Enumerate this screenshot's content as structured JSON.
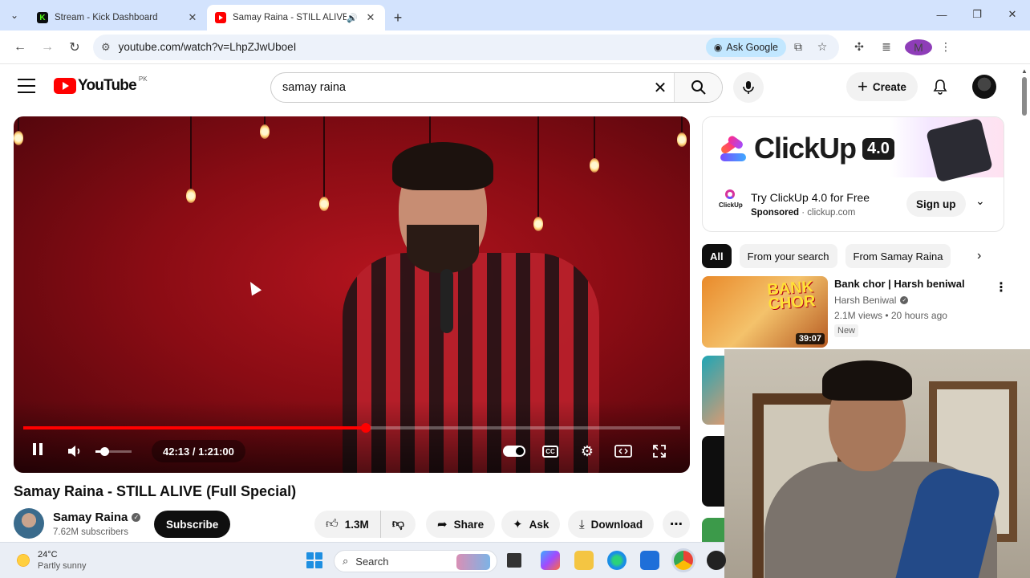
{
  "browser": {
    "tabs": [
      {
        "title": "Stream - Kick Dashboard",
        "favicon": "K",
        "favicon_color": "#53fc18"
      },
      {
        "title": "Samay Raina - STILL ALIVE (",
        "favicon_color": "#ff0000"
      }
    ],
    "url": "youtube.com/watch?v=LhpZJwUboeI",
    "ask_google_label": "Ask Google",
    "profile_initial": "M"
  },
  "youtube": {
    "logo_text": "YouTube",
    "country_code": "PK",
    "search_query": "samay raina",
    "create_label": "Create"
  },
  "player": {
    "time_display": "42:13 / 1:21:00",
    "progress_fraction": 0.521,
    "volume_fraction": 0.25
  },
  "video": {
    "title": "Samay Raina - STILL ALIVE (Full Special)",
    "channel_name": "Samay Raina",
    "subscribers": "7.62M subscribers",
    "subscribe_label": "Subscribe",
    "likes": "1.3M",
    "share_label": "Share",
    "ask_label": "Ask",
    "download_label": "Download"
  },
  "ad": {
    "brand": "ClickUp",
    "version": "4.0",
    "small_logo_text": "ClickUp",
    "title": "Try ClickUp 4.0 for Free",
    "sponsored": "Sponsored",
    "domain": "clickup.com",
    "cta": "Sign up"
  },
  "chips": [
    "All",
    "From your search",
    "From Samay Raina"
  ],
  "recommendations": [
    {
      "title": "Bank chor | Harsh beniwal",
      "channel": "Harsh Beniwal",
      "meta": "2.1M views • 20 hours ago",
      "badge": "New",
      "duration": "39:07",
      "thumb_text": "BANK CHOR"
    }
  ],
  "taskbar": {
    "temperature": "24°C",
    "weather": "Partly sunny",
    "search_placeholder": "Search"
  },
  "colors": {
    "tabstrip": "#d3e3fd",
    "yt_red": "#ff0000",
    "ask_google_bg": "#c2e7ff"
  }
}
